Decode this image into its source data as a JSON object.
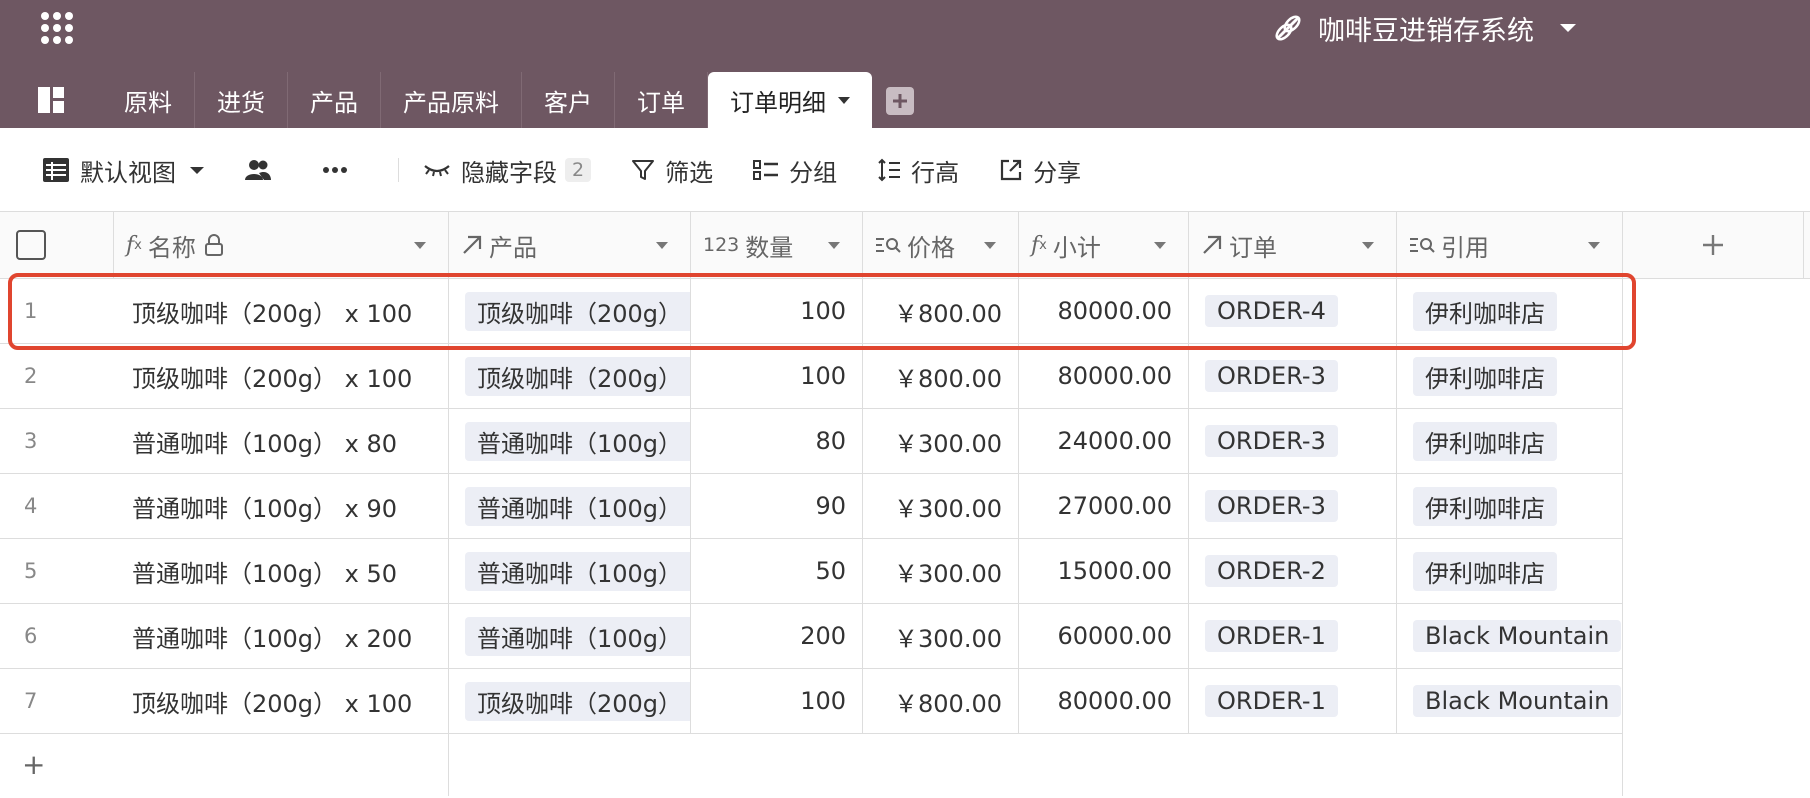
{
  "app": {
    "title": "咖啡豆进销存系统"
  },
  "tabs": [
    "原料",
    "进货",
    "产品",
    "产品原料",
    "客户",
    "订单",
    "订单明细"
  ],
  "active_tab": "订单明细",
  "toolbar": {
    "view": "默认视图",
    "hide_fields": "隐藏字段",
    "hide_count": "2",
    "filter": "筛选",
    "group": "分组",
    "row_height": "行高",
    "share": "分享"
  },
  "columns": [
    {
      "label": "名称",
      "icon": "formula-icon"
    },
    {
      "label": "产品",
      "icon": "link-icon"
    },
    {
      "label": "数量",
      "icon": "number-icon"
    },
    {
      "label": "价格",
      "icon": "lookup-icon"
    },
    {
      "label": "小计",
      "icon": "formula-icon"
    },
    {
      "label": "订单",
      "icon": "link-icon"
    },
    {
      "label": "引用",
      "icon": "lookup-icon"
    }
  ],
  "rows": [
    {
      "n": "1",
      "name": "顶级咖啡（200g） x 100",
      "product": "顶级咖啡（200g）",
      "qty": "100",
      "price": "￥800.00",
      "subtotal": "80000.00",
      "order": "ORDER-4",
      "ref": "伊利咖啡店"
    },
    {
      "n": "2",
      "name": "顶级咖啡（200g） x 100",
      "product": "顶级咖啡（200g）",
      "qty": "100",
      "price": "￥800.00",
      "subtotal": "80000.00",
      "order": "ORDER-3",
      "ref": "伊利咖啡店"
    },
    {
      "n": "3",
      "name": "普通咖啡（100g） x 80",
      "product": "普通咖啡（100g）",
      "qty": "80",
      "price": "￥300.00",
      "subtotal": "24000.00",
      "order": "ORDER-3",
      "ref": "伊利咖啡店"
    },
    {
      "n": "4",
      "name": "普通咖啡（100g） x 90",
      "product": "普通咖啡（100g）",
      "qty": "90",
      "price": "￥300.00",
      "subtotal": "27000.00",
      "order": "ORDER-3",
      "ref": "伊利咖啡店"
    },
    {
      "n": "5",
      "name": "普通咖啡（100g） x 50",
      "product": "普通咖啡（100g）",
      "qty": "50",
      "price": "￥300.00",
      "subtotal": "15000.00",
      "order": "ORDER-2",
      "ref": "伊利咖啡店"
    },
    {
      "n": "6",
      "name": "普通咖啡（100g） x 200",
      "product": "普通咖啡（100g）",
      "qty": "200",
      "price": "￥300.00",
      "subtotal": "60000.00",
      "order": "ORDER-1",
      "ref": "Black Mountain"
    },
    {
      "n": "7",
      "name": "顶级咖啡（200g） x 100",
      "product": "顶级咖啡（200g）",
      "qty": "100",
      "price": "￥800.00",
      "subtotal": "80000.00",
      "order": "ORDER-1",
      "ref": "Black Mountain"
    }
  ],
  "add_row": "+",
  "colors": {
    "topbar": "#6e5762",
    "highlight": "#e0452f",
    "pill": "#eceef5"
  }
}
